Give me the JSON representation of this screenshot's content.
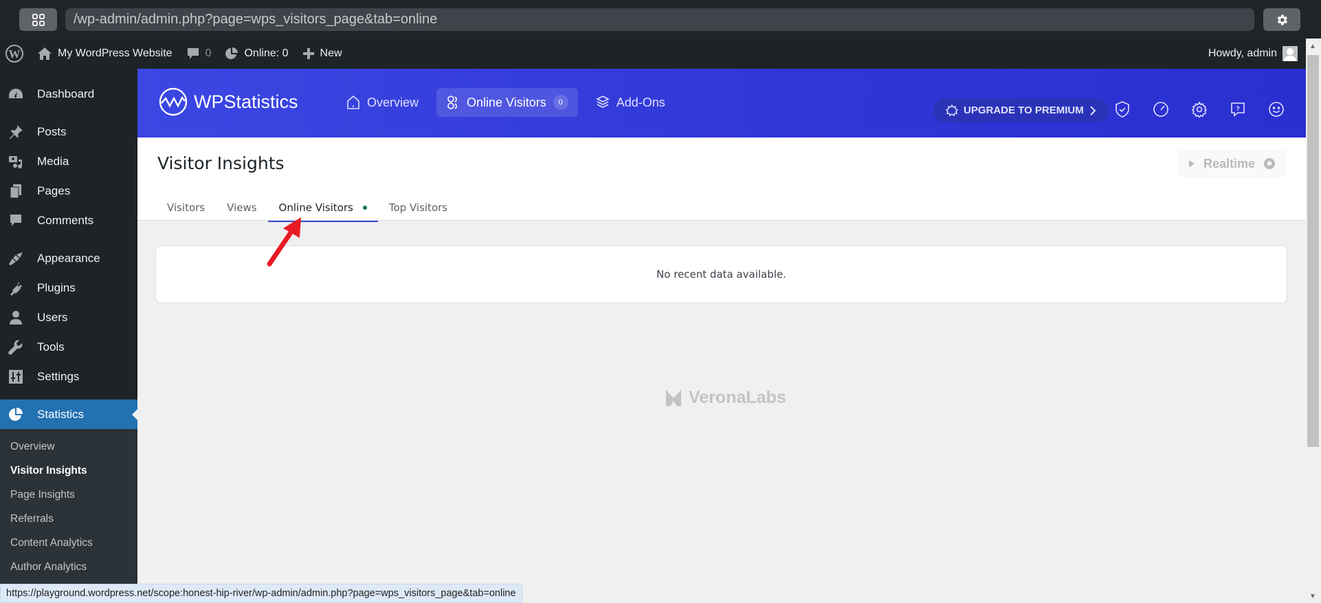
{
  "browser": {
    "url": "/wp-admin/admin.php?page=wps_visitors_page&tab=online",
    "status_url": "https://playground.wordpress.net/scope:honest-hip-river/wp-admin/admin.php?page=wps_visitors_page&tab=online"
  },
  "admin_bar": {
    "site_name": "My WordPress Website",
    "comments_count": "0",
    "online_label": "Online: 0",
    "new_label": "New",
    "howdy": "Howdy, admin"
  },
  "sidebar": {
    "items": [
      {
        "label": "Dashboard",
        "icon": "dashboard-icon"
      },
      {
        "label": "Posts",
        "icon": "pin-icon"
      },
      {
        "label": "Media",
        "icon": "media-icon"
      },
      {
        "label": "Pages",
        "icon": "pages-icon"
      },
      {
        "label": "Comments",
        "icon": "comment-icon"
      },
      {
        "label": "Appearance",
        "icon": "brush-icon"
      },
      {
        "label": "Plugins",
        "icon": "plug-icon"
      },
      {
        "label": "Users",
        "icon": "user-icon"
      },
      {
        "label": "Tools",
        "icon": "wrench-icon"
      },
      {
        "label": "Settings",
        "icon": "settings-icon"
      },
      {
        "label": "Statistics",
        "icon": "pie-chart-icon"
      }
    ],
    "submenu": [
      "Overview",
      "Visitor Insights",
      "Page Insights",
      "Referrals",
      "Content Analytics",
      "Author Analytics"
    ],
    "current_submenu": "Visitor Insights"
  },
  "wps_header": {
    "brand": "WPStatistics",
    "nav": [
      {
        "label": "Overview"
      },
      {
        "label": "Online Visitors",
        "badge": "0"
      },
      {
        "label": "Add-Ons"
      }
    ],
    "upgrade_label": "UPGRADE TO PREMIUM"
  },
  "page": {
    "title": "Visitor Insights",
    "realtime_label": "Realtime",
    "tabs": [
      "Visitors",
      "Views",
      "Online Visitors",
      "Top Visitors"
    ],
    "active_tab": "Online Visitors",
    "empty_message": "No recent data available.",
    "footer_brand": "VeronaLabs"
  },
  "colors": {
    "header_blue": "#3b47e3",
    "active_menu": "#2271b1",
    "online_dot": "#137a4b",
    "annotation_arrow": "#e81c24"
  }
}
